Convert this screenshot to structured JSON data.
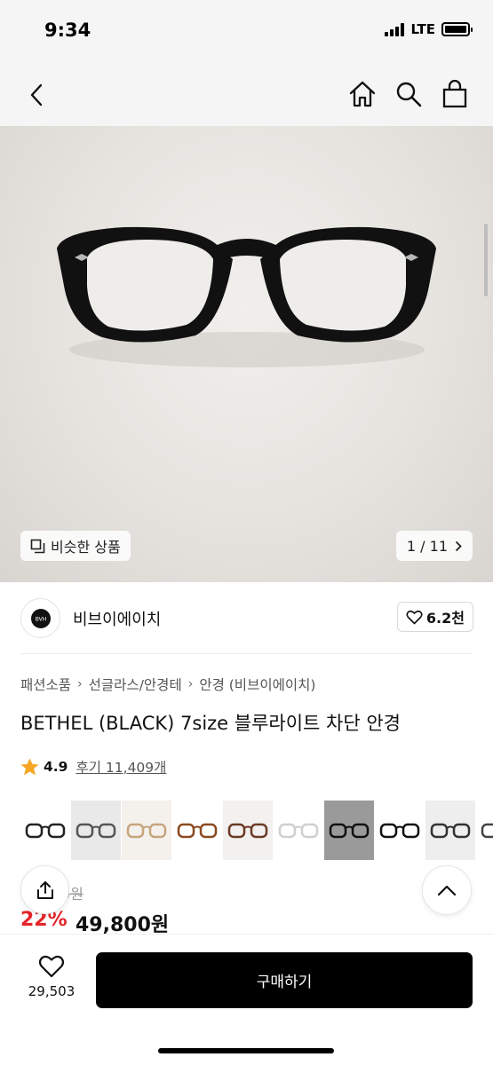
{
  "status": {
    "time": "9:34",
    "network": "LTE"
  },
  "gallery": {
    "similar_label": "비슷한 상품",
    "page_counter": "1 / 11"
  },
  "brand": {
    "logo_text": "BVH",
    "name": "비브이에이치",
    "likes": "6.2천"
  },
  "breadcrumb": [
    "패션소품",
    "선글라스/안경테",
    "안경 (비브이에이치)"
  ],
  "product": {
    "title": "BETHEL (BLACK) 7size 블루라이트 차단 안경",
    "rating": "4.9",
    "reviews": "후기 11,409개",
    "original_price_partial": "0원",
    "discount": "22%",
    "sale_price": "49,800원"
  },
  "thumbnails": [
    {
      "name": "thumb-black-clear-frame",
      "frame": "#222222",
      "bg": "#ffffff"
    },
    {
      "name": "thumb-grey-frame",
      "frame": "#555555",
      "bg": "#e9e9e9"
    },
    {
      "name": "thumb-beige-frame",
      "frame": "#c7a57c",
      "bg": "#f4f1ec"
    },
    {
      "name": "thumb-brown-frame",
      "frame": "#8a4a1f",
      "bg": "#ffffff"
    },
    {
      "name": "thumb-tortoise-frame",
      "frame": "#6b3b22",
      "bg": "#f3f1ef"
    },
    {
      "name": "thumb-clear-frame",
      "frame": "#cfcfcf",
      "bg": "#ffffff"
    },
    {
      "name": "thumb-dark-selected",
      "frame": "#111111",
      "bg": "#9a9a9a"
    },
    {
      "name": "thumb-black-set",
      "frame": "#111111",
      "bg": "#ffffff"
    },
    {
      "name": "thumb-thin-black-frame",
      "frame": "#333333",
      "bg": "#eeeeee"
    },
    {
      "name": "thumb-partial-frame",
      "frame": "#444444",
      "bg": "#ffffff"
    }
  ],
  "bottom": {
    "wish_count": "29,503",
    "buy_label": "구매하기"
  },
  "colors": {
    "accent_red": "#e5252a",
    "star": "#f5a623",
    "button_black": "#000000"
  }
}
